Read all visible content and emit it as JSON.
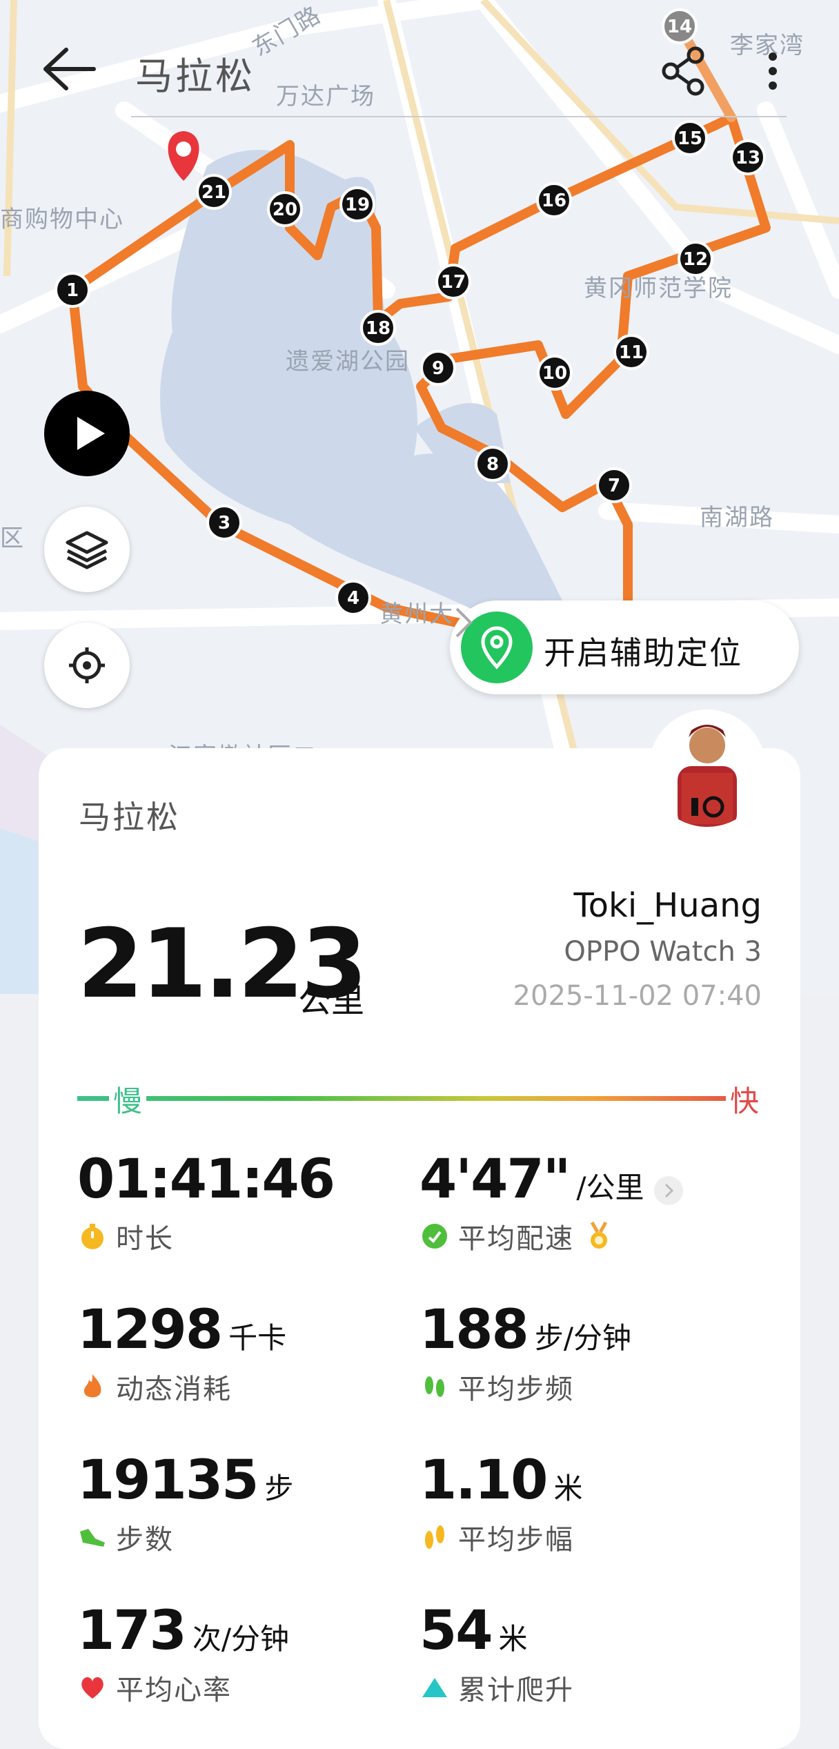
{
  "header": {
    "title": "马拉松",
    "back_icon": "back-arrow-icon",
    "share_icon": "share-icon",
    "more_icon": "more-vertical-icon"
  },
  "map": {
    "labels": {
      "east_gate_road": "东门路",
      "wanda": "万达广场",
      "li_jia_wan": "李家湾",
      "mall": "商购物中心",
      "huanggang_normal": "黄冈师范学院",
      "yiai_lake_park": "遗爱湖公园",
      "nanhu_road": "南湖路",
      "district": "区",
      "huangzhou": "黄州大",
      "jiangjia": "江家墩社区二"
    },
    "markers": [
      "1",
      "3",
      "4",
      "7",
      "8",
      "9",
      "10",
      "11",
      "12",
      "13",
      "14",
      "15",
      "16",
      "17",
      "18",
      "19",
      "20",
      "21"
    ],
    "route_color": "#f07b2a"
  },
  "controls": {
    "play_icon": "play-icon",
    "layers_icon": "layers-icon",
    "locate_icon": "locate-icon",
    "assist_label": "开启辅助定位",
    "assist_icon": "location-pin-icon"
  },
  "card": {
    "title": "马拉松",
    "distance": "21.23",
    "distance_unit": "公里",
    "user_name": "Toki_Huang",
    "device": "OPPO Watch 3",
    "datetime": "2025-11-02 07:40",
    "pace_slow": "慢",
    "pace_fast": "快",
    "stats": {
      "duration": {
        "value": "01:41:46",
        "unit": "",
        "label": "时长",
        "icon": "stopwatch-icon"
      },
      "avg_pace": {
        "value": "4'47\"",
        "unit": "/公里",
        "label": "平均配速",
        "icon": "pace-check-icon",
        "badge_icon": "medal-icon"
      },
      "calories": {
        "value": "1298",
        "unit": "千卡",
        "label": "动态消耗",
        "icon": "flame-icon"
      },
      "cadence": {
        "value": "188",
        "unit": "步/分钟",
        "label": "平均步频",
        "icon": "footprints-icon"
      },
      "steps": {
        "value": "19135",
        "unit": "步",
        "label": "步数",
        "icon": "shoe-icon"
      },
      "stride": {
        "value": "1.10",
        "unit": "米",
        "label": "平均步幅",
        "icon": "stride-icon"
      },
      "heart_rate": {
        "value": "173",
        "unit": "次/分钟",
        "label": "平均心率",
        "icon": "heart-icon"
      },
      "elevation": {
        "value": "54",
        "unit": "米",
        "label": "累计爬升",
        "icon": "triangle-up-icon"
      }
    }
  }
}
